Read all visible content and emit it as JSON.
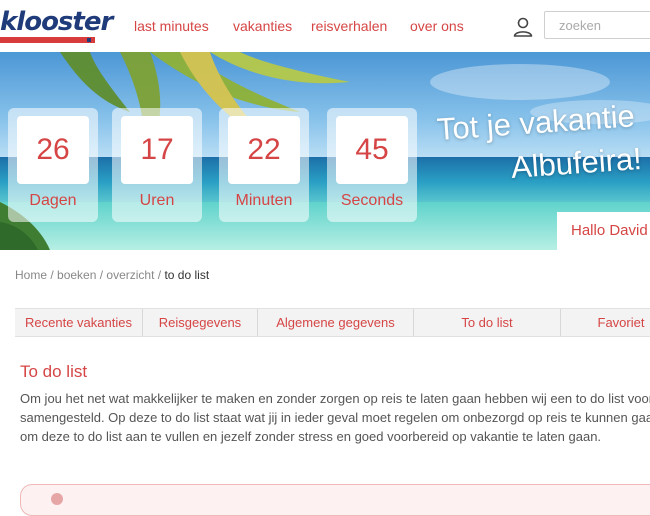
{
  "header": {
    "logo_text": "klooster",
    "nav": [
      "last minutes",
      "vakanties",
      "reisverhalen",
      "over ons"
    ],
    "search_placeholder": "zoeken"
  },
  "hero": {
    "countdown": [
      {
        "value": "26",
        "label": "Dagen"
      },
      {
        "value": "17",
        "label": "Uren"
      },
      {
        "value": "22",
        "label": "Minuten"
      },
      {
        "value": "45",
        "label": "Seconds"
      }
    ],
    "title_line1": "Tot je vakantie",
    "title_line2": "Albufeira!",
    "greeting": "Hallo David"
  },
  "breadcrumb": {
    "items": [
      "Home",
      "boeken",
      "overzicht"
    ],
    "current": "to do list"
  },
  "tabs": [
    "Recente vakanties",
    "Reisgegevens",
    "Algemene gegevens",
    "To do list",
    "Favoriet"
  ],
  "content": {
    "title": "To do list",
    "lines": [
      "Om jou het net wat makkelijker te maken en zonder zorgen op reis te laten gaan hebben wij een to do list voor je",
      "samengesteld. Op deze to do list staat wat jij in ieder geval moet regelen om onbezorgd op reis te kunnen gaan. V",
      "om deze to do list aan te vullen en jezelf zonder stress en goed voorbereid op vakantie te laten gaan."
    ]
  },
  "colors": {
    "accent": "#d64545",
    "brand_blue": "#1f3b7a"
  }
}
